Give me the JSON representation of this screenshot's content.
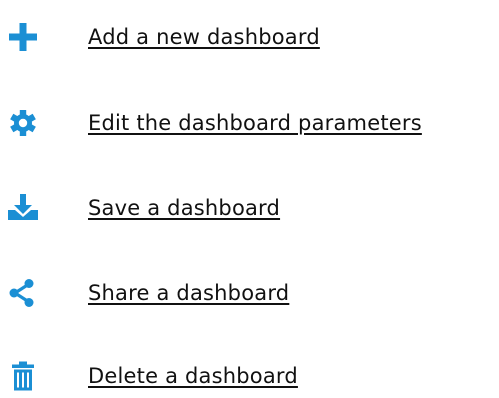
{
  "actions": [
    {
      "label": "Add a new dashboard",
      "icon": "plus-icon"
    },
    {
      "label": "Edit the dashboard parameters",
      "icon": "gear-icon"
    },
    {
      "label": "Save a dashboard",
      "icon": "download-tray-icon"
    },
    {
      "label": "Share a dashboard",
      "icon": "share-icon"
    },
    {
      "label": "Delete a dashboard",
      "icon": "trash-icon"
    }
  ],
  "colors": {
    "icon": "#1b8fd4",
    "text": "#111111"
  }
}
